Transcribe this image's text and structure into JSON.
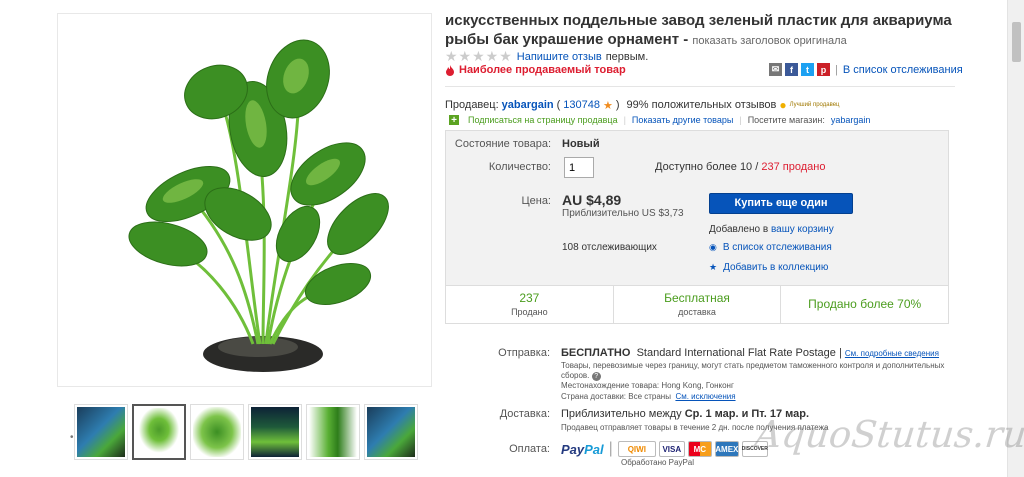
{
  "title": {
    "text": "искусственных поддельные завод зеленый пластик для аквариума рыбы бак украшение орнамент -",
    "show_original": "показать заголовок оригинала"
  },
  "rating": {
    "write_review": "Напишите отзыв",
    "first": "первым."
  },
  "bestseller": "Наиболее продаваемый товар",
  "watchlist_link": "В список отслеживания",
  "seller": {
    "label": "Продавец:",
    "name": "yabargain",
    "feedback_count": "130748",
    "positive": "99% положительных отзывов",
    "top_rated": "Лучший продавец",
    "subscribe": "Подписаться на страницу продавца",
    "other_items": "Показать другие товары",
    "visit_store": "Посетите магазин:",
    "store_name": "yabargain"
  },
  "buybox": {
    "condition_label": "Состояние товара:",
    "condition_value": "Новый",
    "quantity_label": "Количество:",
    "quantity_value": "1",
    "available_text": "Доступно более 10 /",
    "sold_text": "237 продано",
    "price_label": "Цена:",
    "price": "AU $4,89",
    "price_approx": "Приблизительно US $3,73",
    "buy_button": "Купить еще один",
    "added_text": "Добавлено в",
    "cart_link": "вашу корзину",
    "watchers": "108 отслеживающих",
    "add_watch": "В список отслеживания",
    "add_collection": "Добавить в коллекцию"
  },
  "stats": [
    {
      "big": "237",
      "small": "Продано"
    },
    {
      "big": "Бесплатная",
      "small": "доставка"
    },
    {
      "big": "Продано более 70%",
      "small": ""
    }
  ],
  "shipping": {
    "label": "Отправка:",
    "free": "БЕСПЛАТНО",
    "method": "Standard International Flat Rate Postage |",
    "details_link": "См. подробные сведения",
    "customs_note": "Товары, перевозимые через границу, могут стать предметом таможенного контроля и дополнительных",
    "customs_note2": "сборов.",
    "location": "Местонахождение товара: Hong Kong, Гонконг",
    "countries": "Страна доставки:  Все страны",
    "exclusions_link": "См. исключения"
  },
  "delivery": {
    "label": "Доставка:",
    "text": "Приблизительно между",
    "dates": "Ср. 1 мар. и Пт. 17 мар.",
    "note": "Продавец отправляет товары в течение 2 дн. после получения платежа"
  },
  "payment": {
    "label": "Оплата:",
    "paypal_1": "Pay",
    "paypal_2": "Pal",
    "cards": [
      "QIWI",
      "VISA",
      "MC",
      "AMEX",
      "DISCOVER"
    ],
    "note": "Обработано PayPal"
  },
  "watermark": "AquoStutus.ru"
}
